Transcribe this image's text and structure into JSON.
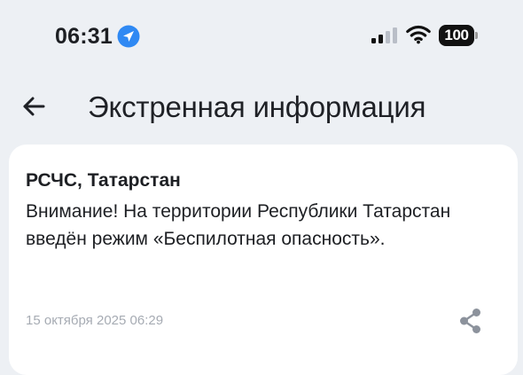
{
  "status_bar": {
    "time": "06:31",
    "battery_level": "100",
    "icons": {
      "location": "location-arrow-icon",
      "signal": "signal-strength-icon",
      "wifi": "wifi-icon",
      "battery": "battery-icon"
    },
    "colors": {
      "location_badge": "#2f89f3",
      "signal_active": "#111111",
      "signal_inactive": "#b9bec7"
    }
  },
  "header": {
    "back_icon": "arrow-left-icon",
    "title": "Экстренная информация"
  },
  "alert_card": {
    "sender": "РСЧС, Татарстан",
    "message": "Внимание! На территории Республики Татарстан введён режим «Беспилотная опасность».",
    "timestamp": "15 октября 2025 06:29",
    "share_icon": "share-icon"
  },
  "colors": {
    "background": "#edf0f4",
    "card": "#ffffff",
    "text_primary": "#1d1f23",
    "text_secondary": "#a6abb3",
    "icon_secondary": "#8c929c"
  }
}
